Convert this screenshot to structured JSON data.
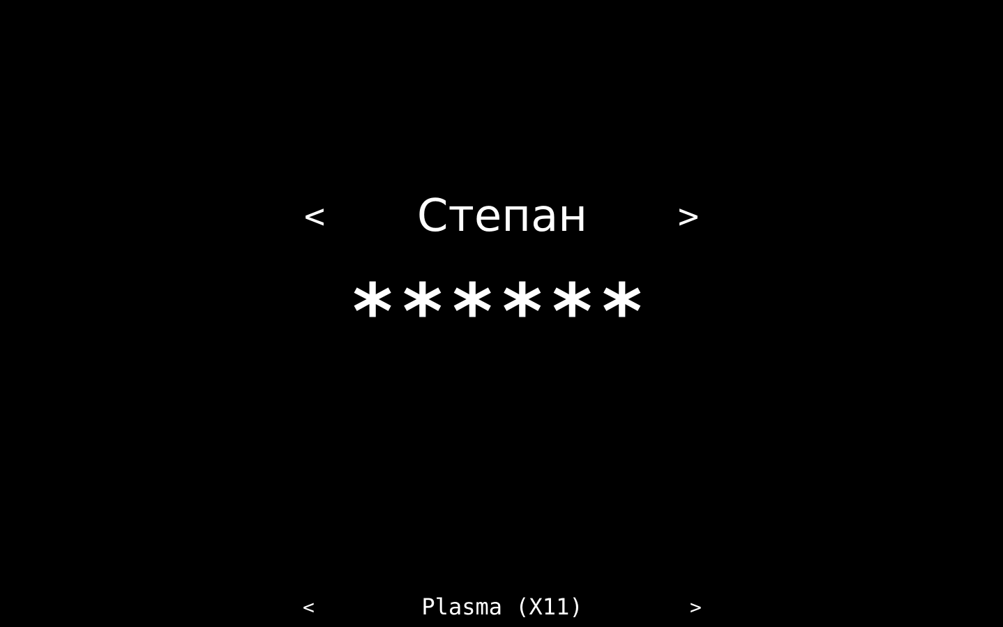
{
  "user_selector": {
    "prev_label": "<",
    "name": "Степан",
    "next_label": ">"
  },
  "password": {
    "masked_value": "******"
  },
  "session_selector": {
    "prev_label": "<",
    "name": "Plasma (X11)",
    "next_label": ">"
  },
  "colors": {
    "background": "#000000",
    "foreground": "#ffffff"
  }
}
